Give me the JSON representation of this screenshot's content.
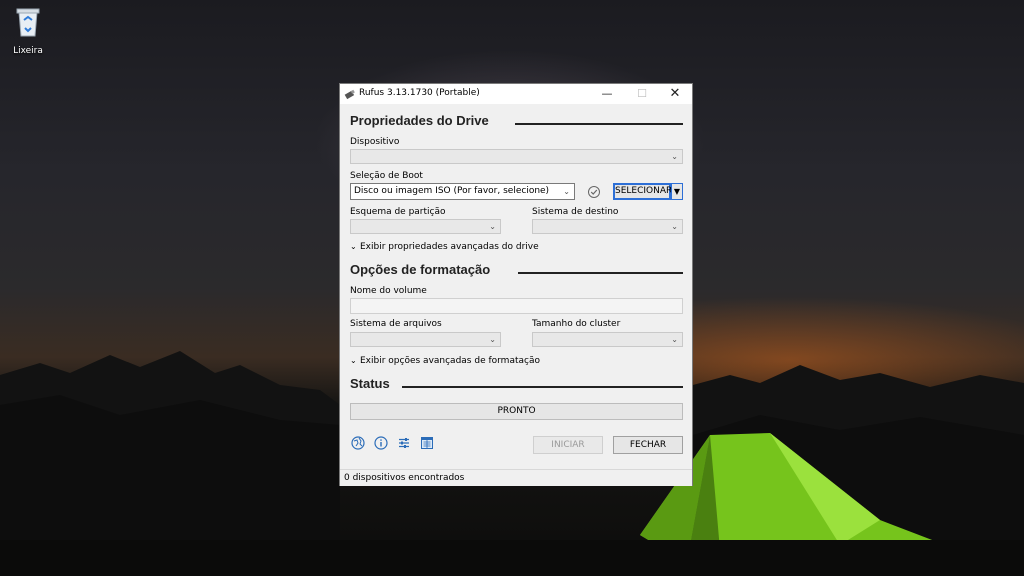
{
  "desktop": {
    "recycle_bin_label": "Lixeira"
  },
  "window": {
    "title": "Rufus 3.13.1730 (Portable)",
    "min_symbol": "—",
    "max_symbol": "☐",
    "close_symbol": "✕"
  },
  "drive": {
    "section_title": "Propriedades do Drive",
    "device_label": "Dispositivo",
    "device_value": "",
    "boot_label": "Seleção de Boot",
    "boot_value": "Disco ou imagem ISO (Por favor, selecione)",
    "select_button": "SELECIONAR",
    "partition_label": "Esquema de partição",
    "target_label": "Sistema de destino",
    "advanced_toggle": "Exibir propriedades avançadas do drive"
  },
  "format": {
    "section_title": "Opções de formatação",
    "volume_label": "Nome do volume",
    "volume_value": "",
    "filesystem_label": "Sistema de arquivos",
    "cluster_label": "Tamanho do cluster",
    "advanced_toggle": "Exibir opções avançadas de formatação"
  },
  "status": {
    "section_title": "Status",
    "value": "PRONTO"
  },
  "buttons": {
    "start": "INICIAR",
    "close": "FECHAR"
  },
  "footer": {
    "devices_found": "0 dispositivos encontrados"
  },
  "icons": [
    "globe-icon",
    "info-icon",
    "settings-icon",
    "log-icon",
    "check-icon"
  ],
  "colors": {
    "accent": "#2d6fd6",
    "tent_green": "#7ed321"
  }
}
